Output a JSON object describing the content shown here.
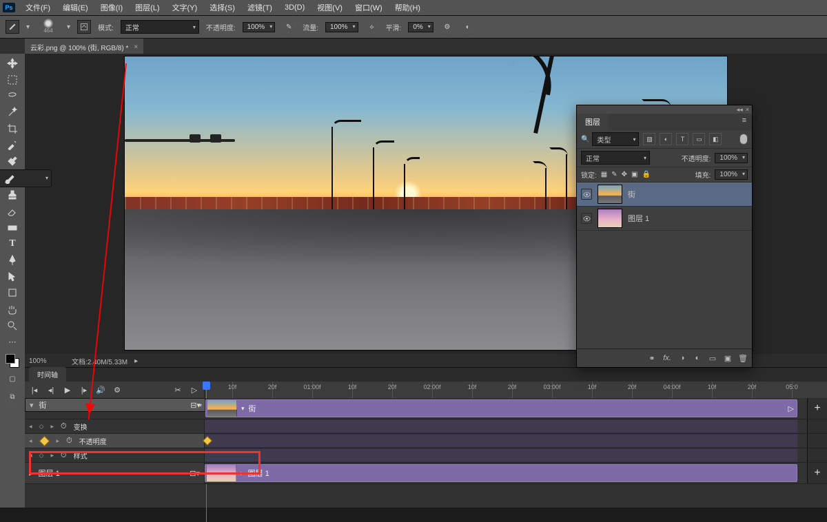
{
  "menu": {
    "items": [
      "文件(F)",
      "编辑(E)",
      "图像(I)",
      "图层(L)",
      "文字(Y)",
      "选择(S)",
      "滤镜(T)",
      "3D(D)",
      "视图(V)",
      "窗口(W)",
      "帮助(H)"
    ]
  },
  "options": {
    "brush_size": "464",
    "mode_label": "模式:",
    "mode_value": "正常",
    "opacity_label": "不透明度:",
    "opacity_value": "100%",
    "flow_label": "流量:",
    "flow_value": "100%",
    "smooth_label": "平滑:",
    "smooth_value": "0%"
  },
  "doc_tab": {
    "title": "云彩.png @ 100% (街, RGB/8) *",
    "close": "×"
  },
  "status": {
    "zoom": "100%",
    "info": "文档:2.40M/5.33M"
  },
  "layers_panel": {
    "tab": "图层",
    "filter_label": "类型",
    "blend": "正常",
    "opacity_label": "不透明度:",
    "opacity_value": "100%",
    "lock_label": "锁定:",
    "fill_label": "填充:",
    "fill_value": "100%",
    "layers": [
      {
        "name": "街",
        "selected": true,
        "thumb": "sunset"
      },
      {
        "name": "图层 1",
        "selected": false,
        "thumb": "cloud"
      }
    ]
  },
  "timeline": {
    "tab": "时间轴",
    "ruler_labels": [
      "10f",
      "20f",
      "01:00f",
      "10f",
      "20f",
      "02:00f",
      "10f",
      "20f",
      "03:00f",
      "10f",
      "20f",
      "04:00f",
      "10f",
      "20f",
      "05:0"
    ],
    "rows": {
      "main": {
        "name": "街",
        "clip_label": "街"
      },
      "sub1": {
        "name": "变换"
      },
      "sub2": {
        "name": "不透明度"
      },
      "sub3": {
        "name": "样式"
      },
      "second": {
        "name": "图层 1",
        "clip_label": "图层 1"
      }
    },
    "add": "+"
  }
}
